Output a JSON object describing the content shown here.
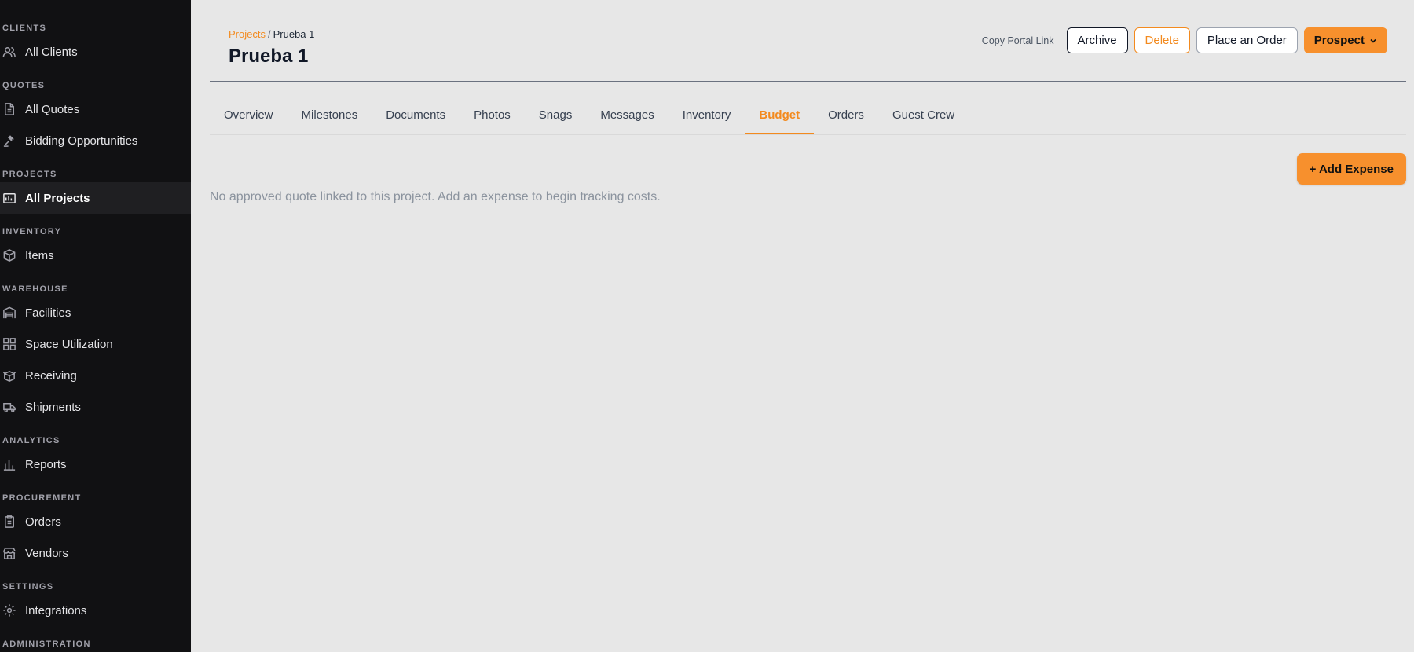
{
  "sidebar": {
    "sections": [
      {
        "title": "CLIENTS",
        "items": [
          {
            "label": "All Clients",
            "icon": "users-icon"
          }
        ]
      },
      {
        "title": "QUOTES",
        "items": [
          {
            "label": "All Quotes",
            "icon": "document-icon"
          },
          {
            "label": "Bidding Opportunities",
            "icon": "gavel-icon"
          }
        ]
      },
      {
        "title": "PROJECTS",
        "items": [
          {
            "label": "All Projects",
            "icon": "projects-icon",
            "active": true
          }
        ]
      },
      {
        "title": "INVENTORY",
        "items": [
          {
            "label": "Items",
            "icon": "cube-icon"
          }
        ]
      },
      {
        "title": "WAREHOUSE",
        "items": [
          {
            "label": "Facilities",
            "icon": "warehouse-icon"
          },
          {
            "label": "Space Utilization",
            "icon": "grid-icon"
          },
          {
            "label": "Receiving",
            "icon": "box-open-icon"
          },
          {
            "label": "Shipments",
            "icon": "truck-icon"
          }
        ]
      },
      {
        "title": "ANALYTICS",
        "items": [
          {
            "label": "Reports",
            "icon": "bar-chart-icon"
          }
        ]
      },
      {
        "title": "PROCUREMENT",
        "items": [
          {
            "label": "Orders",
            "icon": "clipboard-icon"
          },
          {
            "label": "Vendors",
            "icon": "store-icon"
          }
        ]
      },
      {
        "title": "SETTINGS",
        "items": [
          {
            "label": "Integrations",
            "icon": "gear-icon"
          }
        ]
      },
      {
        "title": "ADMINISTRATION",
        "items": []
      }
    ]
  },
  "header": {
    "breadcrumb_link": "Projects",
    "breadcrumb_sep": "/",
    "breadcrumb_current": "Prueba 1",
    "title": "Prueba 1",
    "copy_link": "Copy Portal Link",
    "archive": "Archive",
    "delete": "Delete",
    "place_order": "Place an Order",
    "status": "Prospect"
  },
  "tabs": [
    "Overview",
    "Milestones",
    "Documents",
    "Photos",
    "Snags",
    "Messages",
    "Inventory",
    "Budget",
    "Orders",
    "Guest Crew"
  ],
  "active_tab": "Budget",
  "budget": {
    "add_expense": "+ Add Expense",
    "empty_message": "No approved quote linked to this project. Add an expense to begin tracking costs."
  },
  "colors": {
    "accent": "#f7902d",
    "sidebar_bg": "#111113",
    "page_bg": "#e7e7e7"
  }
}
